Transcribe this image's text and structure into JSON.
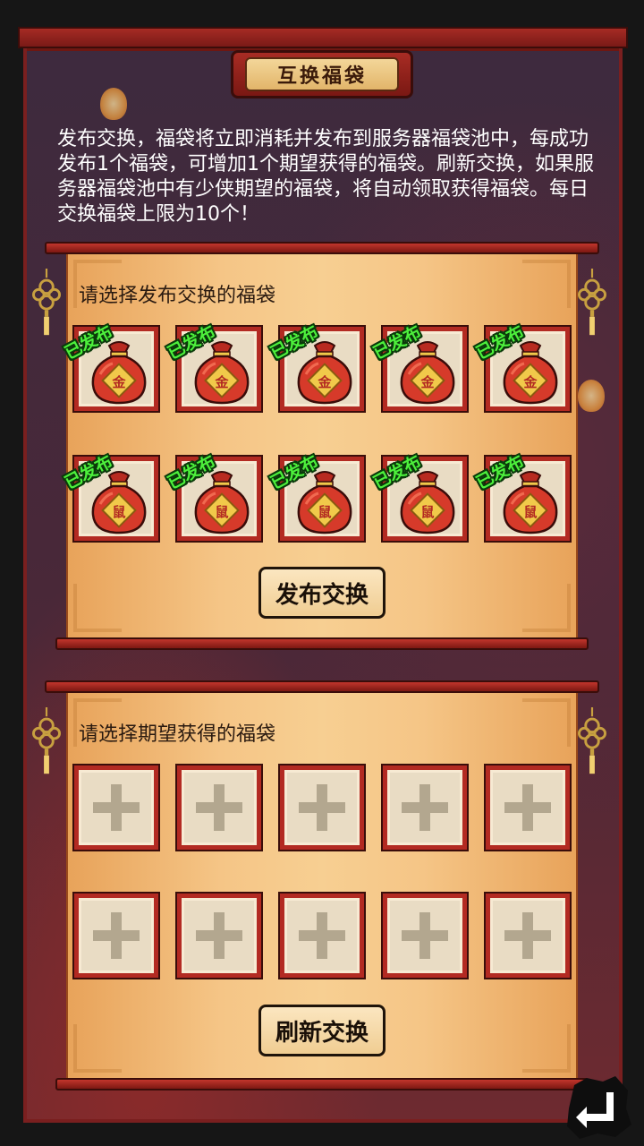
{
  "title": "互换福袋",
  "intro": "发布交换，福袋将立即消耗并发布到服务器福袋池中，每成功发布1个福袋，可增加1个期望获得的福袋。刷新交换，如果服务器福袋池中有少侠期望的福袋，将自动领取获得福袋。每日交换福袋上限为10个！",
  "publish_panel": {
    "label": "请选择发布交换的福袋",
    "posted_tag": "已发布",
    "row1_glyph": "金",
    "row2_glyph": "鼠",
    "button": "发布交换"
  },
  "expect_panel": {
    "label": "请选择期望获得的福袋",
    "button": "刷新交换"
  },
  "icons": {
    "bag": "lucky-bag-icon",
    "plus": "plus-icon",
    "back": "return-arrow-icon",
    "knot": "chinese-knot-icon"
  },
  "colors": {
    "posted_green": "#4df03c",
    "frame_red": "#b32a22",
    "bag_red": "#d63a2a",
    "label_gold": "#f1c94a"
  }
}
